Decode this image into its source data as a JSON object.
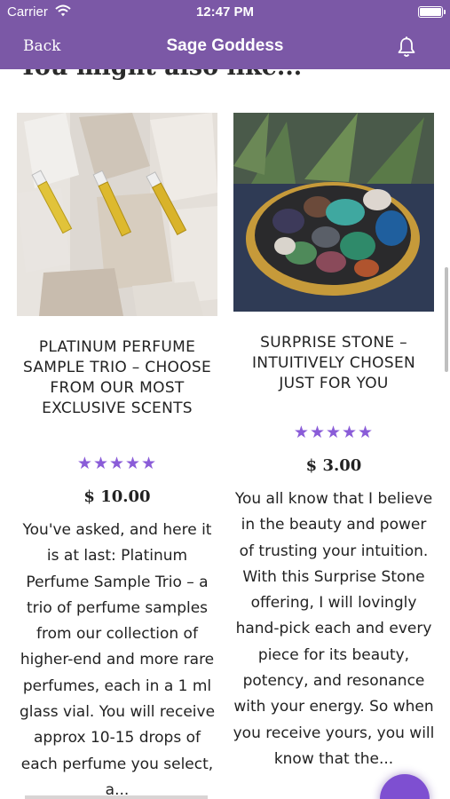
{
  "status_bar": {
    "carrier": "Carrier",
    "time": "12:47 PM"
  },
  "nav": {
    "back": "Back",
    "title": "Sage Goddess"
  },
  "section": {
    "heading": "You might also like..."
  },
  "products": [
    {
      "name": "PLATINUM PERFUME SAMPLE TRIO – CHOOSE FROM OUR MOST EXCLUSIVE SCENTS",
      "rating": "★★★★★",
      "price": "$ 10.00",
      "description": "You've asked, and here it is at last: Platinum Perfume Sample Trio – a trio of perfume samples from our collection of higher-end and more rare perfumes, each in a 1 ml glass vial. You will receive approx 10-15 drops of each perfume you select, a..."
    },
    {
      "name": "SURPRISE STONE – INTUITIVELY CHOSEN JUST FOR YOU",
      "rating": "★★★★★",
      "price": "$ 3.00",
      "description": "You all know that I believe in the beauty and power of trusting your intuition. With this Surprise Stone offering, I will lovingly hand-pick each and every piece for its beauty, potency, and resonance with your energy. So when you receive yours, you will know that the..."
    }
  ],
  "colors": {
    "brand": "#7b58a6",
    "stars": "#8a5cd8",
    "fab": "#7e4fd1"
  },
  "icons": {
    "nav_right": "bell-icon",
    "status_wifi": "wifi-icon",
    "status_battery": "battery-icon"
  }
}
